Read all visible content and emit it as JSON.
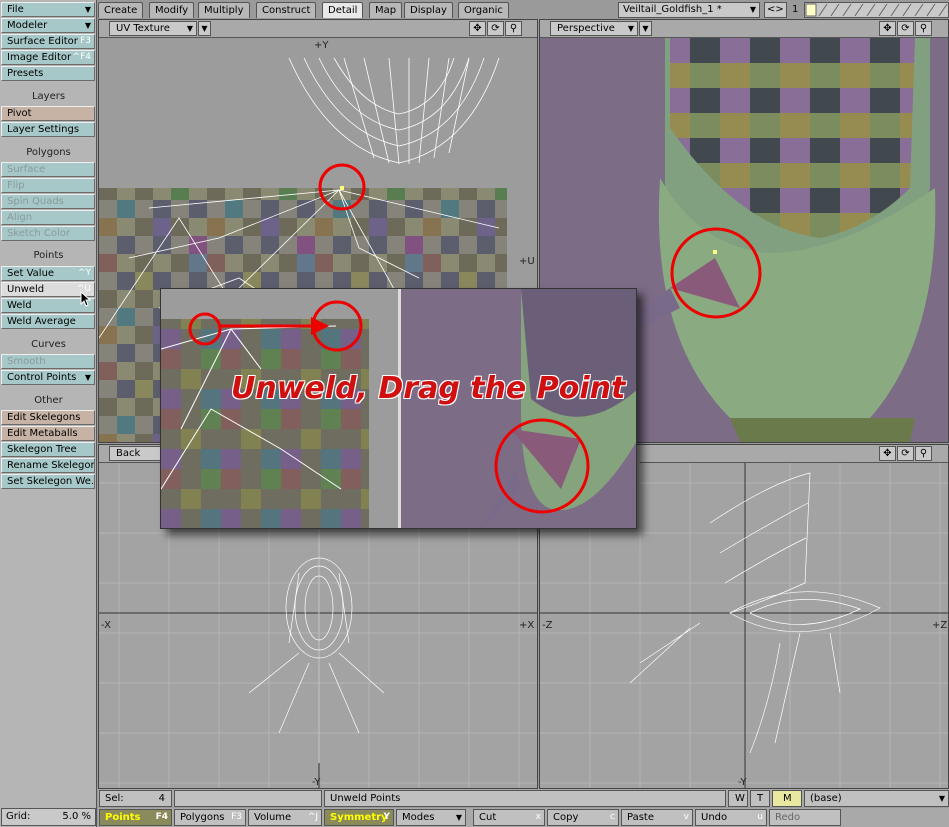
{
  "sidebar": {
    "file": "File",
    "modeler": "Modeler",
    "surface_editor": "Surface Editor",
    "surface_editor_key": "F3",
    "image_editor": "Image Editor",
    "image_editor_key": "^F4",
    "presets": "Presets",
    "layers_heading": "Layers",
    "pivot": "Pivot",
    "layer_settings": "Layer Settings",
    "polygons_heading": "Polygons",
    "surface": "Surface",
    "flip": "Flip",
    "spin_quads": "Spin Quads",
    "align": "Align",
    "sketch_color": "Sketch Color",
    "points_heading": "Points",
    "set_value": "Set Value",
    "set_value_key": "^Y",
    "unweld": "Unweld",
    "unweld_key": "^U",
    "weld": "Weld",
    "weld_average": "Weld Average",
    "curves_heading": "Curves",
    "smooth": "Smooth",
    "control_points": "Control Points",
    "edit_skelegons": "Edit Skelegons",
    "edit_metaballs": "Edit Metaballs",
    "skelegon_tree": "Skelegon Tree",
    "rename_skelegon": "Rename Skelegon",
    "set_skelegon_weight": "Set Skelegon We...",
    "other_heading": "Other",
    "grid_label": "Grid:",
    "grid_value": "5.0 %"
  },
  "tabs": [
    "Create",
    "Modify",
    "Multiply",
    "Construct",
    "Detail",
    "Map",
    "Display",
    "Organic"
  ],
  "active_tab": "Detail",
  "object_name": "Veiltail_Goldfish_1 *",
  "layer_number": "1",
  "viewports": {
    "top_left": {
      "mode": "UV Texture",
      "axis_top": "+Y",
      "axis_right": "+U"
    },
    "top_right": {
      "mode": "Perspective"
    },
    "bottom_left": {
      "mode": "Back",
      "axis_left": "-X",
      "axis_right": "+X",
      "axis_bottom": "-Y"
    },
    "bottom_right": {
      "axis_left": "-Z",
      "axis_right": "+Z",
      "axis_bottom": "-Y"
    }
  },
  "callout": {
    "text": "Unweld, Drag the Point"
  },
  "status": {
    "sel_label": "Sel:",
    "sel_value": "4",
    "message": "Unweld Points",
    "w": "W",
    "t": "T",
    "m": "M",
    "layer": "(base)"
  },
  "toolbar": {
    "points": "Points",
    "points_key": "F4",
    "polygons": "Polygons",
    "polygons_key": "F3",
    "volume": "Volume",
    "volume_key": "^J",
    "symmetry": "Symmetry",
    "symmetry_key": "Y",
    "modes": "Modes",
    "cut": "Cut",
    "cut_key": "x",
    "copy": "Copy",
    "copy_key": "c",
    "paste": "Paste",
    "paste_key": "v",
    "undo": "Undo",
    "undo_key": "u",
    "redo": "Redo"
  }
}
